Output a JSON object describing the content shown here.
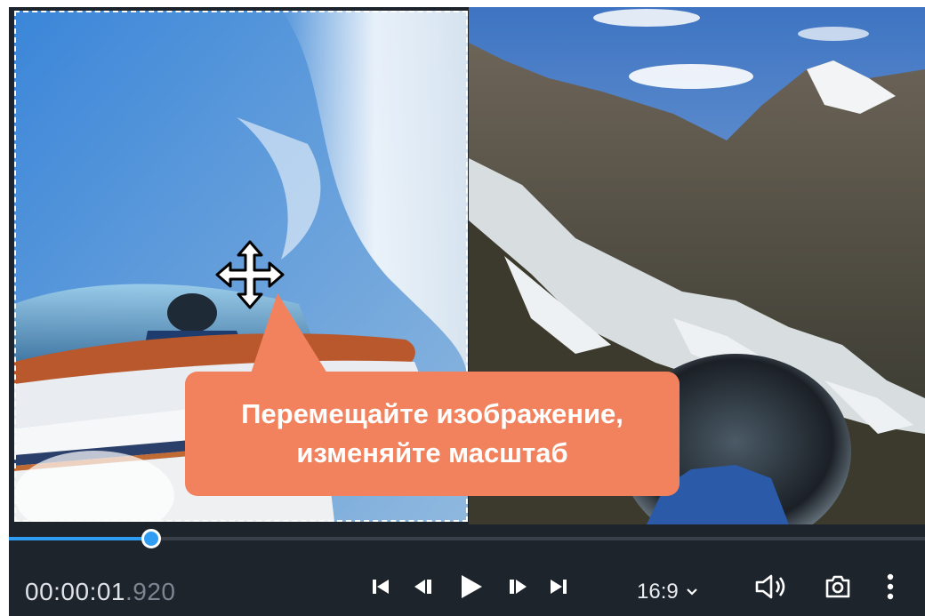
{
  "preview": {
    "overlay_text_line1": "Перемещайте изображение,",
    "overlay_text_line2": "изменяйте масштаб",
    "overlay_color": "#f2825e"
  },
  "playback": {
    "time_main": "00:00:01",
    "time_ms": ".920",
    "progress_fraction": 0.155,
    "accent_color": "#2f9df4"
  },
  "controls": {
    "skip_start_icon": "skip-to-start-icon",
    "prev_frame_icon": "previous-frame-icon",
    "play_icon": "play-icon",
    "next_frame_icon": "next-frame-icon",
    "skip_end_icon": "skip-to-end-icon",
    "aspect_ratio": "16:9",
    "volume_icon": "volume-icon",
    "snapshot_icon": "camera-icon",
    "more_icon": "more-vertical-icon"
  }
}
